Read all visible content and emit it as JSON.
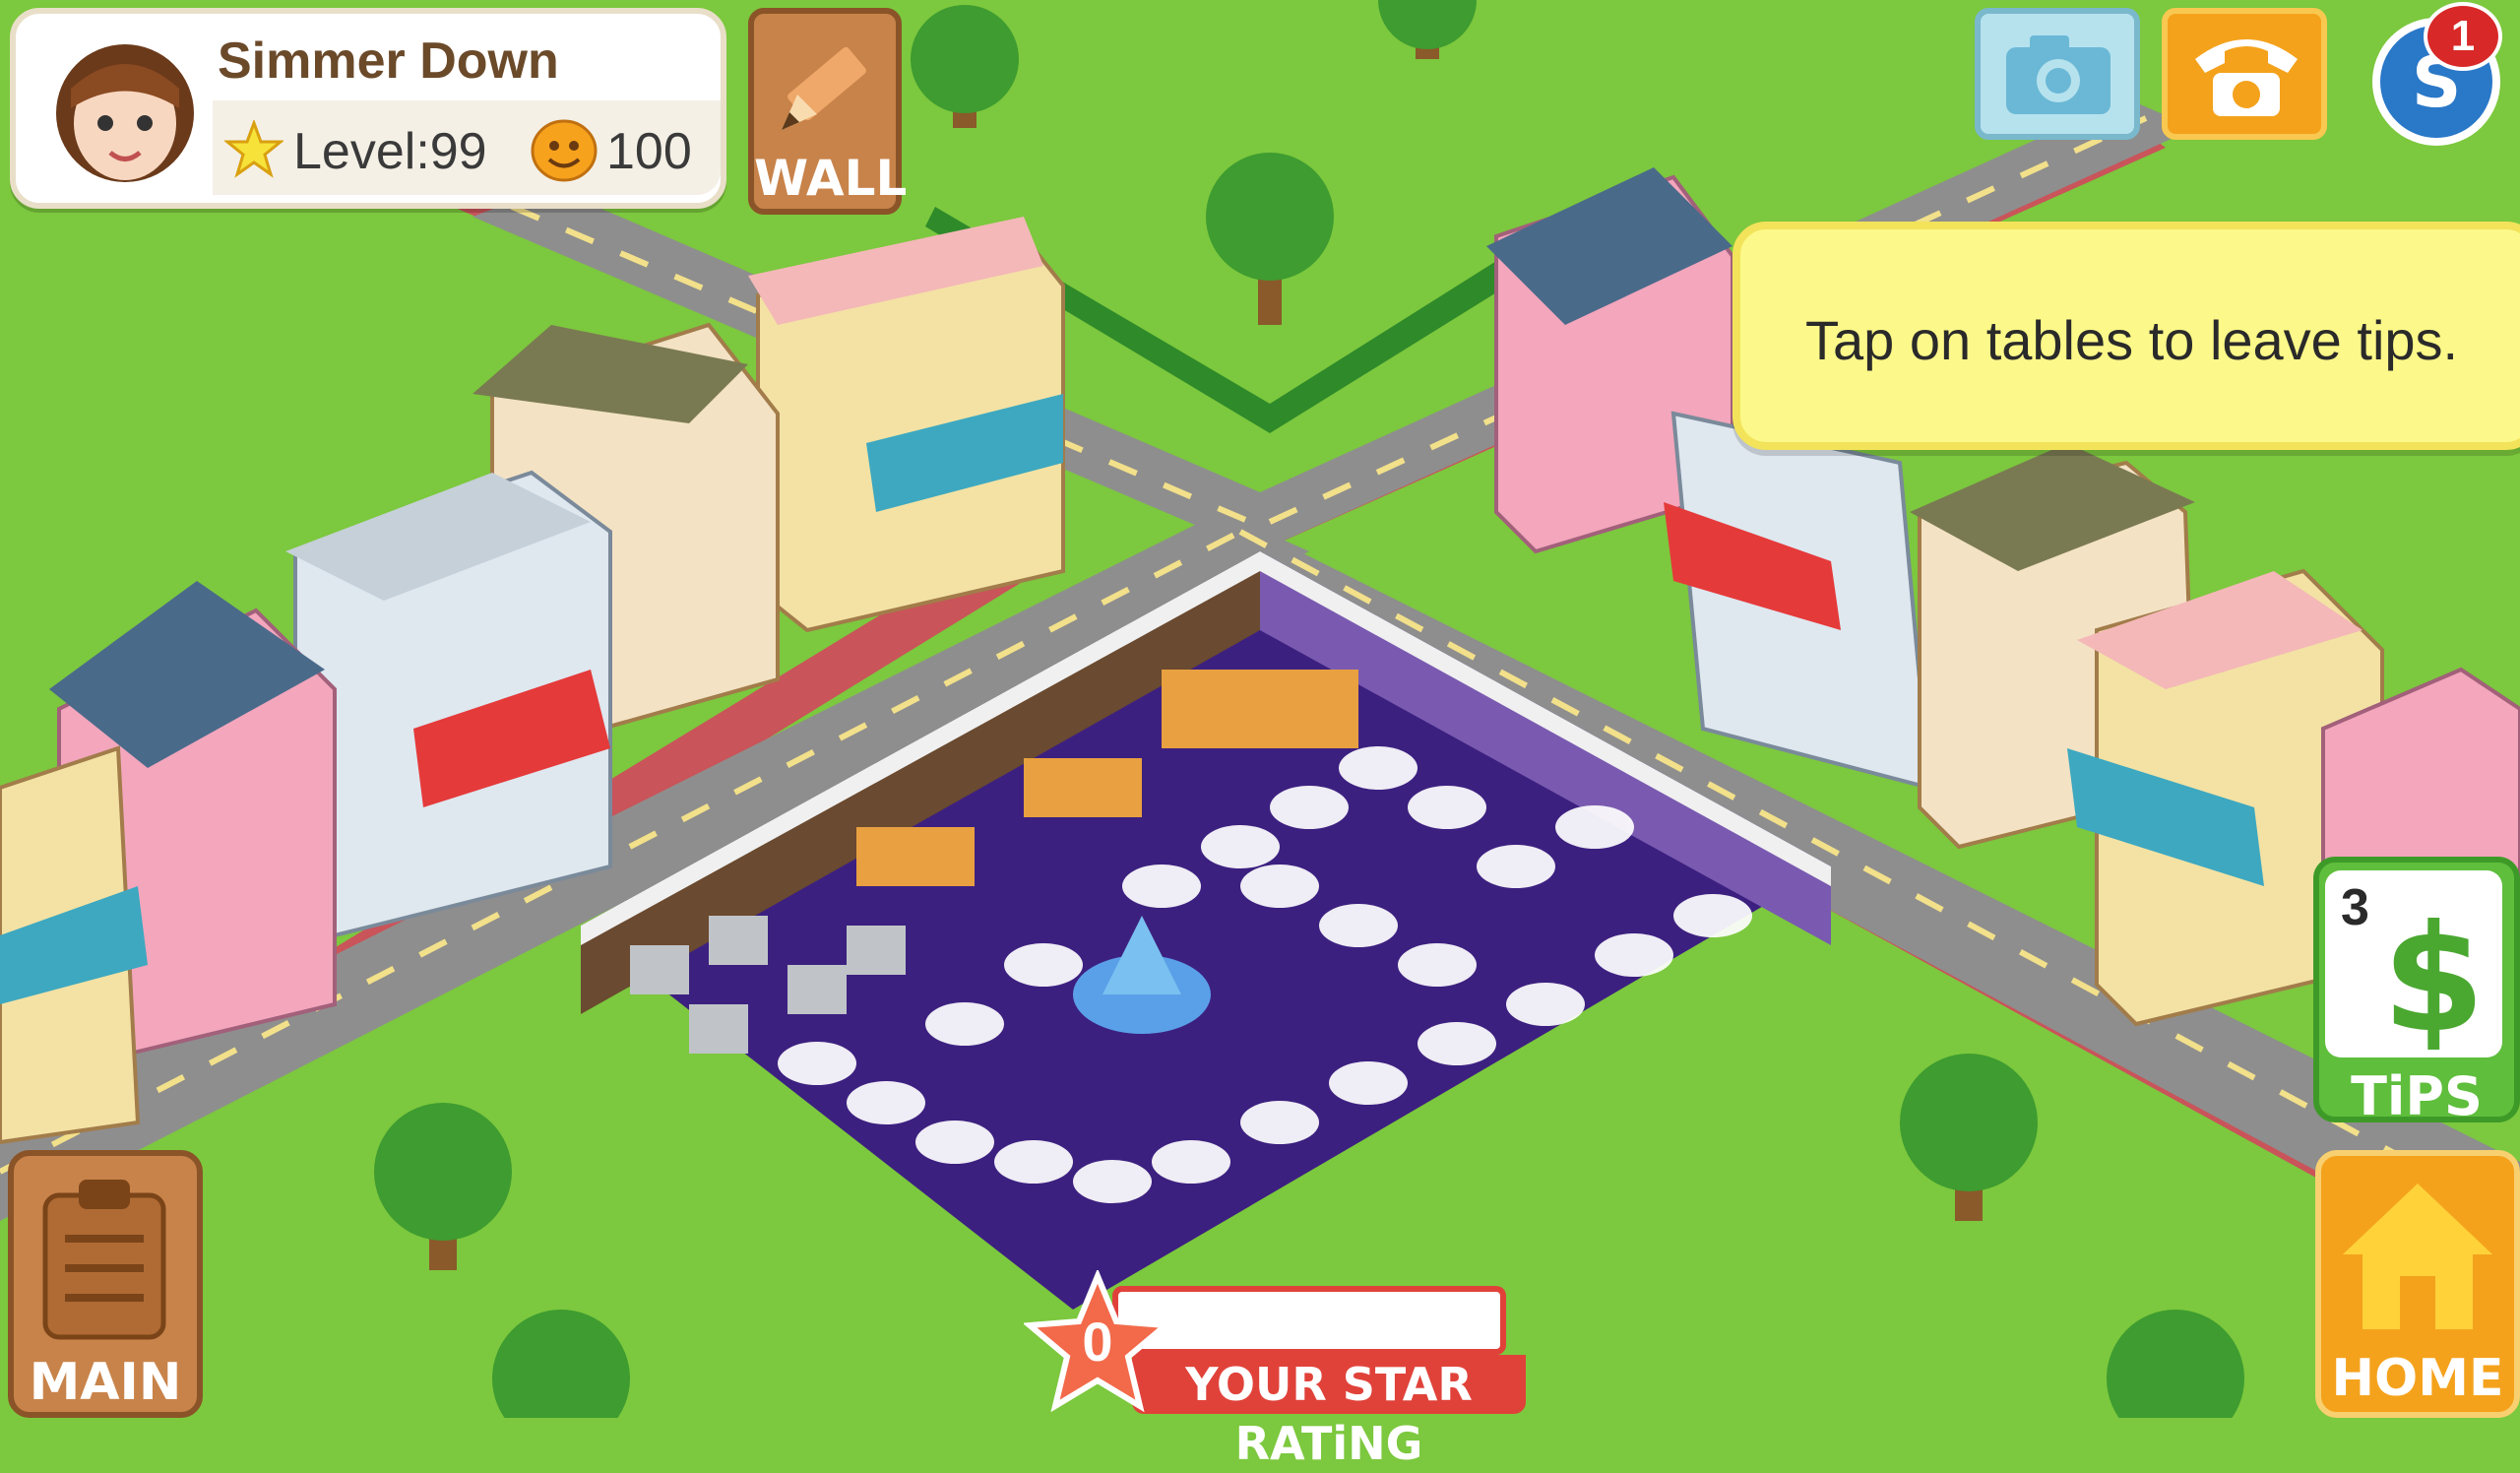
{
  "profile": {
    "name": "Simmer Down",
    "level_label": "Level:",
    "level": "99",
    "coins": "100"
  },
  "buttons": {
    "wall": "WALL",
    "main": "MAIN",
    "home": "HOME",
    "tips": "TiPS"
  },
  "tips_count": "3",
  "notification_badge": "1",
  "tip_message": "Tap on tables to leave tips.",
  "star_rating": {
    "label": "YOUR STAR RATiNG",
    "value": "0"
  },
  "colors": {
    "grass": "#7cc83e",
    "road": "#8a8a8a",
    "sidewalk": "#c9545a",
    "floor": "#3c2080",
    "wall": "#7a5ab0",
    "tip_box": "#fcf889",
    "button_orange": "#f4a21c",
    "button_green": "#5fbe3c",
    "button_brown": "#9a5a2c"
  }
}
